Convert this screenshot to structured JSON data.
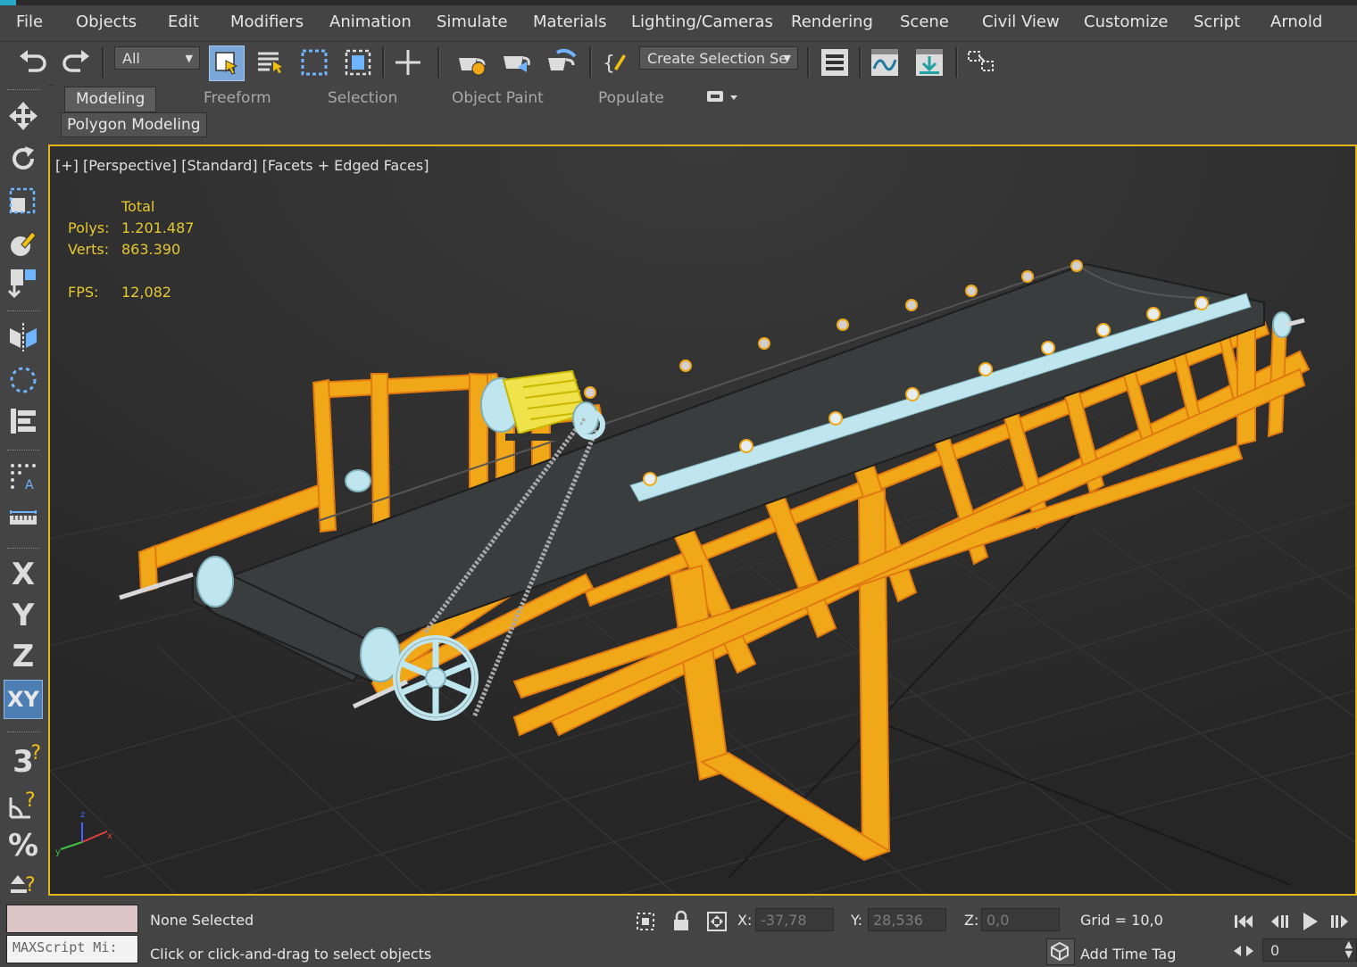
{
  "menu": [
    "File",
    "Objects",
    "Edit",
    "Modifiers",
    "Animation",
    "Simulate",
    "Materials",
    "Lighting/Cameras",
    "Rendering",
    "Scene",
    "Civil View",
    "Customize",
    "Script",
    "Arnold"
  ],
  "toolbar": {
    "filter_value": "All",
    "selection_set_placeholder": "Create Selection Se",
    "icons": [
      "undo-icon",
      "redo-icon",
      "select-object-icon",
      "select-by-name-icon",
      "rectangular-selection-icon",
      "window-crossing-icon",
      "select-move-icon",
      "render-setup-icon",
      "rendered-frame-window-icon",
      "render-production-icon",
      "edit-named-sets-icon",
      "layer-manager-icon",
      "curve-editor-icon",
      "schematic-view-icon",
      "material-editor-icon"
    ]
  },
  "ribbon": {
    "tabs": [
      "Modeling",
      "Freeform",
      "Selection",
      "Object Paint",
      "Populate"
    ],
    "active_tab": "Modeling",
    "panel_label": "Polygon Modeling"
  },
  "left_tools": [
    "move-icon",
    "rotate-icon",
    "scale-icon",
    "place-icon",
    "align-icon",
    "mirror-icon",
    "selection-lock-icon",
    "array-icon",
    "snap-icon",
    "measure-icon",
    "x-axis-constraint",
    "y-axis-constraint",
    "z-axis-constraint",
    "xy-plane-constraint",
    "snap-3d-icon",
    "angle-snap-icon",
    "percent-snap-icon",
    "spinner-snap-icon"
  ],
  "axis_letters": {
    "x": "X",
    "y": "Y",
    "z": "Z",
    "xy": "XY",
    "snap3": "3"
  },
  "viewport": {
    "label": "[+] [Perspective] [Standard] [Facets + Edged Faces]",
    "stats_header": "Total",
    "polys_label": "Polys:",
    "polys_value": "1.201.487",
    "verts_label": "Verts:",
    "verts_value": "863.390",
    "fps_label": "FPS:",
    "fps_value": "12,082"
  },
  "status": {
    "selection": "None Selected",
    "prompt": "Click or click-and-drag to select objects",
    "maxscript": "MAXScript Mi:",
    "x_label": "X:",
    "x_value": "-37,78",
    "y_label": "Y:",
    "y_value": "28,536",
    "z_label": "Z:",
    "z_value": "0,0",
    "grid": "Grid = 10,0",
    "add_time_tag": "Add Time Tag",
    "frame_value": "0"
  },
  "colors": {
    "frame": "#f0a818",
    "belt": "#3a3d3e",
    "roller": "#bfe6ee",
    "selection_border": "#e0b51e",
    "stats_text": "#e6c830"
  }
}
